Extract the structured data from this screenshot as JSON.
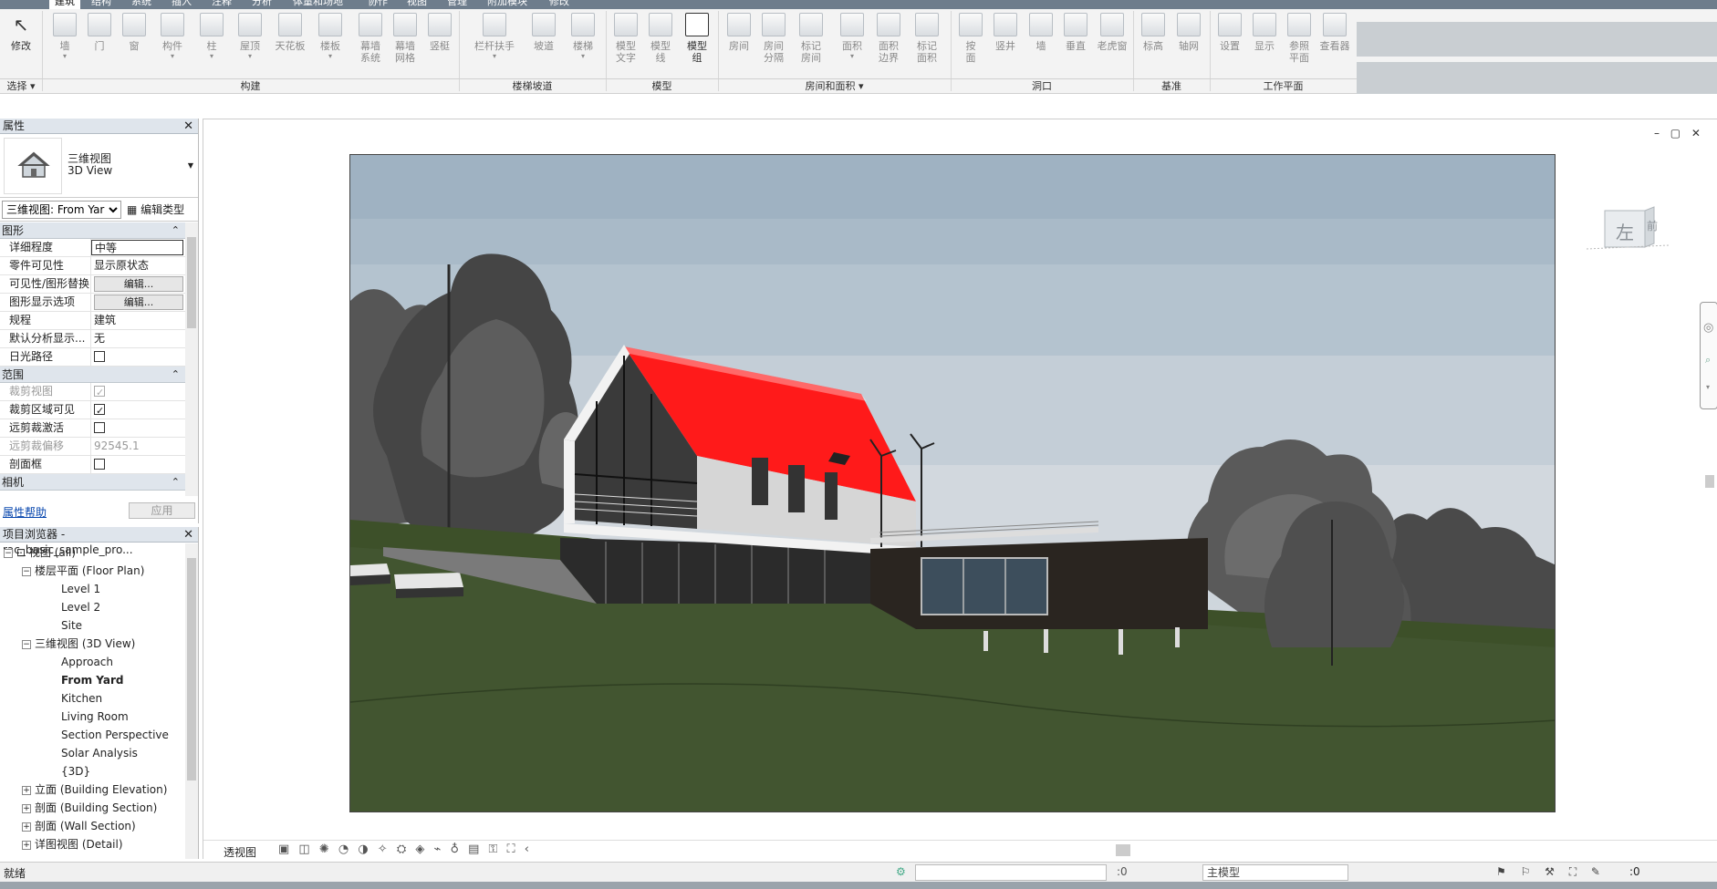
{
  "app_tabs": [
    "建筑",
    "结构",
    "系统",
    "插入",
    "注释",
    "分析",
    "体量和场地",
    "协作",
    "视图",
    "管理",
    "附加模块",
    "修改"
  ],
  "ribbon": {
    "tools": [
      {
        "label": "修改",
        "label2": ""
      },
      {
        "label": "墙",
        "label2": ""
      },
      {
        "label": "门",
        "label2": ""
      },
      {
        "label": "窗",
        "label2": ""
      },
      {
        "label": "构件",
        "label2": ""
      },
      {
        "label": "柱",
        "label2": ""
      },
      {
        "label": "屋顶",
        "label2": ""
      },
      {
        "label": "天花板",
        "label2": ""
      },
      {
        "label": "楼板",
        "label2": ""
      },
      {
        "label": "幕墙",
        "label2": "系统"
      },
      {
        "label": "幕墙",
        "label2": "网格"
      },
      {
        "label": "竖梃",
        "label2": ""
      },
      {
        "label": "栏杆扶手",
        "label2": ""
      },
      {
        "label": "坡道",
        "label2": ""
      },
      {
        "label": "楼梯",
        "label2": ""
      },
      {
        "label": "模型",
        "label2": "文字"
      },
      {
        "label": "模型",
        "label2": "线"
      },
      {
        "label": "模型",
        "label2": "组"
      },
      {
        "label": "房间",
        "label2": ""
      },
      {
        "label": "房间",
        "label2": "分隔"
      },
      {
        "label": "标记",
        "label2": "房间"
      },
      {
        "label": "面积",
        "label2": ""
      },
      {
        "label": "面积",
        "label2": "边界"
      },
      {
        "label": "标记",
        "label2": "面积"
      },
      {
        "label": "按",
        "label2": "面"
      },
      {
        "label": "竖井",
        "label2": ""
      },
      {
        "label": "墙",
        "label2": ""
      },
      {
        "label": "垂直",
        "label2": ""
      },
      {
        "label": "老虎窗",
        "label2": ""
      },
      {
        "label": "标高",
        "label2": ""
      },
      {
        "label": "轴网",
        "label2": ""
      },
      {
        "label": "设置",
        "label2": ""
      },
      {
        "label": "显示",
        "label2": ""
      },
      {
        "label": "参照",
        "label2": "平面"
      },
      {
        "label": "查看器",
        "label2": ""
      }
    ],
    "panels": [
      "选择 ▾",
      "构建",
      "楼梯坡道",
      "模型",
      "房间和面积 ▾",
      "洞口",
      "基准",
      "工作平面"
    ]
  },
  "properties": {
    "title": "属性",
    "type_name_1": "三维视图",
    "type_name_2": "3D View",
    "instance_selector": "三维视图: From Yar",
    "edit_type": "编辑类型",
    "groups": [
      {
        "name": "图形",
        "rows": [
          {
            "k": "详细程度",
            "v": "中等"
          },
          {
            "k": "零件可见性",
            "v": "显示原状态"
          },
          {
            "k": "可见性/图形替换",
            "v": "编辑..."
          },
          {
            "k": "图形显示选项",
            "v": "编辑..."
          },
          {
            "k": "规程",
            "v": "建筑"
          },
          {
            "k": "默认分析显示...",
            "v": "无"
          },
          {
            "k": "日光路径",
            "v": ""
          }
        ]
      },
      {
        "name": "范围",
        "rows": [
          {
            "k": "裁剪视图",
            "v": ""
          },
          {
            "k": "裁剪区域可见",
            "v": ""
          },
          {
            "k": "远剪裁激活",
            "v": ""
          },
          {
            "k": "远剪裁偏移",
            "v": "92545.1"
          },
          {
            "k": "剖面框",
            "v": ""
          }
        ]
      },
      {
        "name": "相机",
        "rows": []
      }
    ],
    "help_link": "属性帮助",
    "apply": "应用"
  },
  "browser": {
    "title": "项目浏览器 - rac_basic_sample_pro...",
    "nodes": [
      {
        "label": "视图 (all)",
        "toggle": "−"
      },
      {
        "label": "楼层平面 (Floor Plan)",
        "toggle": "−"
      },
      {
        "label": "Level 1",
        "toggle": ""
      },
      {
        "label": "Level 2",
        "toggle": ""
      },
      {
        "label": "Site",
        "toggle": ""
      },
      {
        "label": "三维视图 (3D View)",
        "toggle": "−"
      },
      {
        "label": "Approach",
        "toggle": ""
      },
      {
        "label": "From Yard",
        "toggle": ""
      },
      {
        "label": "Kitchen",
        "toggle": ""
      },
      {
        "label": "Living Room",
        "toggle": ""
      },
      {
        "label": "Section Perspective",
        "toggle": ""
      },
      {
        "label": "Solar Analysis",
        "toggle": ""
      },
      {
        "label": "{3D}",
        "toggle": ""
      },
      {
        "label": "立面 (Building Elevation)",
        "toggle": "+"
      },
      {
        "label": "剖面 (Building Section)",
        "toggle": "+"
      },
      {
        "label": "剖面 (Wall Section)",
        "toggle": "+"
      },
      {
        "label": "详图视图 (Detail)",
        "toggle": "+"
      }
    ]
  },
  "view": {
    "controls": "– ▢ ✕",
    "viewcube_left": "左",
    "viewcube_front": "前",
    "status_label": "透视图",
    "status_icons": "▣ ◫ ✺ ◔ ◑ ✧ ⛭ ◈ ⌁ ♁ ▤ ⚿ ⛶ ‹"
  },
  "statusbar": {
    "ready": "就绪",
    "zero_1": ":0",
    "model": "主模型",
    "right_icons": "⚑ ⚐ ⚒ ⛶ ✎",
    "zero_2": ":0"
  },
  "colors": {
    "roof": "#ff1a1a",
    "grass": "#3d5029",
    "sky_top": "#9fb2c2",
    "sky_bottom": "#d8dde2"
  }
}
